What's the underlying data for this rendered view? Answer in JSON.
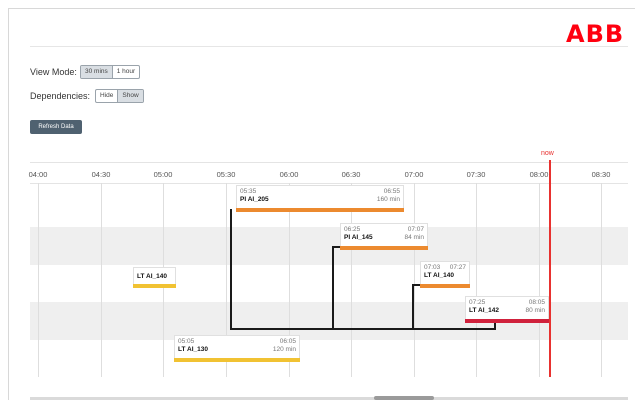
{
  "brand": {
    "logo_text": "ABB",
    "color": "#ff000f"
  },
  "controls": {
    "view_mode_label": "View Mode:",
    "view_mode_options": [
      "30 mins",
      "1 hour"
    ],
    "view_mode_selected": "30 mins",
    "dependencies_label": "Dependencies:",
    "dependencies_options": [
      "Hide",
      "Show"
    ],
    "dependencies_selected": "Show",
    "refresh_label": "Refresh Data"
  },
  "timeline": {
    "ticks": [
      "04:00",
      "04:30",
      "05:00",
      "05:30",
      "06:00",
      "06:30",
      "07:00",
      "07:30",
      "08:00",
      "08:30"
    ],
    "now_label": "now",
    "colors": {
      "now": "#e8312f",
      "orange": "#ec8a2f",
      "yellow": "#f1c232",
      "red": "#d0213c"
    }
  },
  "tasks": [
    {
      "name": "PI AI_205",
      "start": "05:35",
      "end": "06:55",
      "duration": "160 min",
      "color": "orange"
    },
    {
      "name": "PI AI_145",
      "start": "06:25",
      "end": "07:07",
      "duration": "84 min",
      "color": "orange"
    },
    {
      "name": "LT AI_140",
      "start": "",
      "end": "",
      "duration": "",
      "color": "yellow"
    },
    {
      "name": "LT AI_140",
      "start": "07:03",
      "end": "07:27",
      "duration": "",
      "color": "orange"
    },
    {
      "name": "LT AI_142",
      "start": "07:25",
      "end": "08:05",
      "duration": "80 min",
      "color": "red"
    },
    {
      "name": "LT AI_130",
      "start": "05:05",
      "end": "06:05",
      "duration": "120 min",
      "color": "yellow"
    }
  ]
}
